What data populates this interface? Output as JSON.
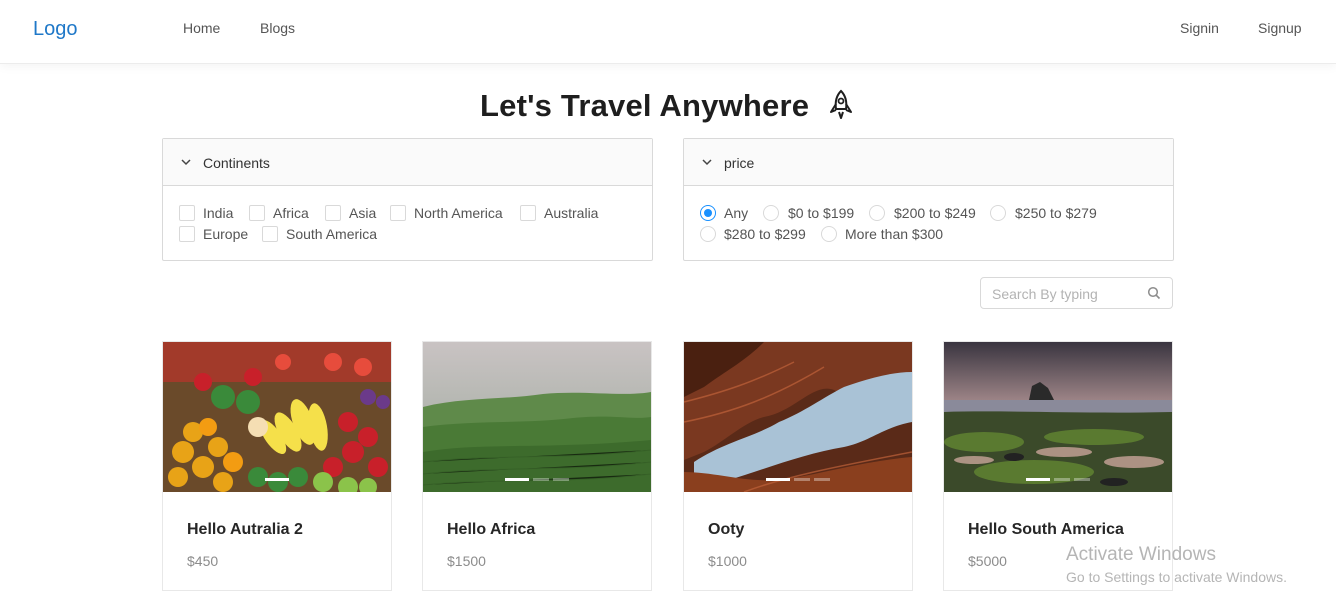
{
  "header": {
    "logo": "Logo",
    "nav": {
      "home": "Home",
      "blogs": "Blogs"
    },
    "auth": {
      "signin": "Signin",
      "signup": "Signup"
    }
  },
  "page": {
    "title": "Let's Travel Anywhere",
    "title_icon": "rocket-icon"
  },
  "filters": {
    "continents": {
      "title": "Continents",
      "options": [
        "India",
        "Africa",
        "Asia",
        "North America",
        "Australia",
        "Europe",
        "South America"
      ],
      "checked": []
    },
    "price": {
      "title": "price",
      "options": [
        "Any",
        "$0 to $199",
        "$200 to $249",
        "$250 to $279",
        "$280 to $299",
        "More than $300"
      ],
      "selected": "Any"
    }
  },
  "search": {
    "placeholder": "Search By typing",
    "icon": "search-icon"
  },
  "cards": [
    {
      "title": "Hello Autralia 2",
      "price": "$450"
    },
    {
      "title": "Hello Africa",
      "price": "$1500"
    },
    {
      "title": "Ooty",
      "price": "$1000"
    },
    {
      "title": "Hello South America",
      "price": "$5000"
    }
  ],
  "watermark": {
    "line1": "Activate Windows",
    "line2": "Go to Settings to activate Windows."
  },
  "colors": {
    "accent": "#1890ff",
    "logo": "#1f78c8"
  }
}
